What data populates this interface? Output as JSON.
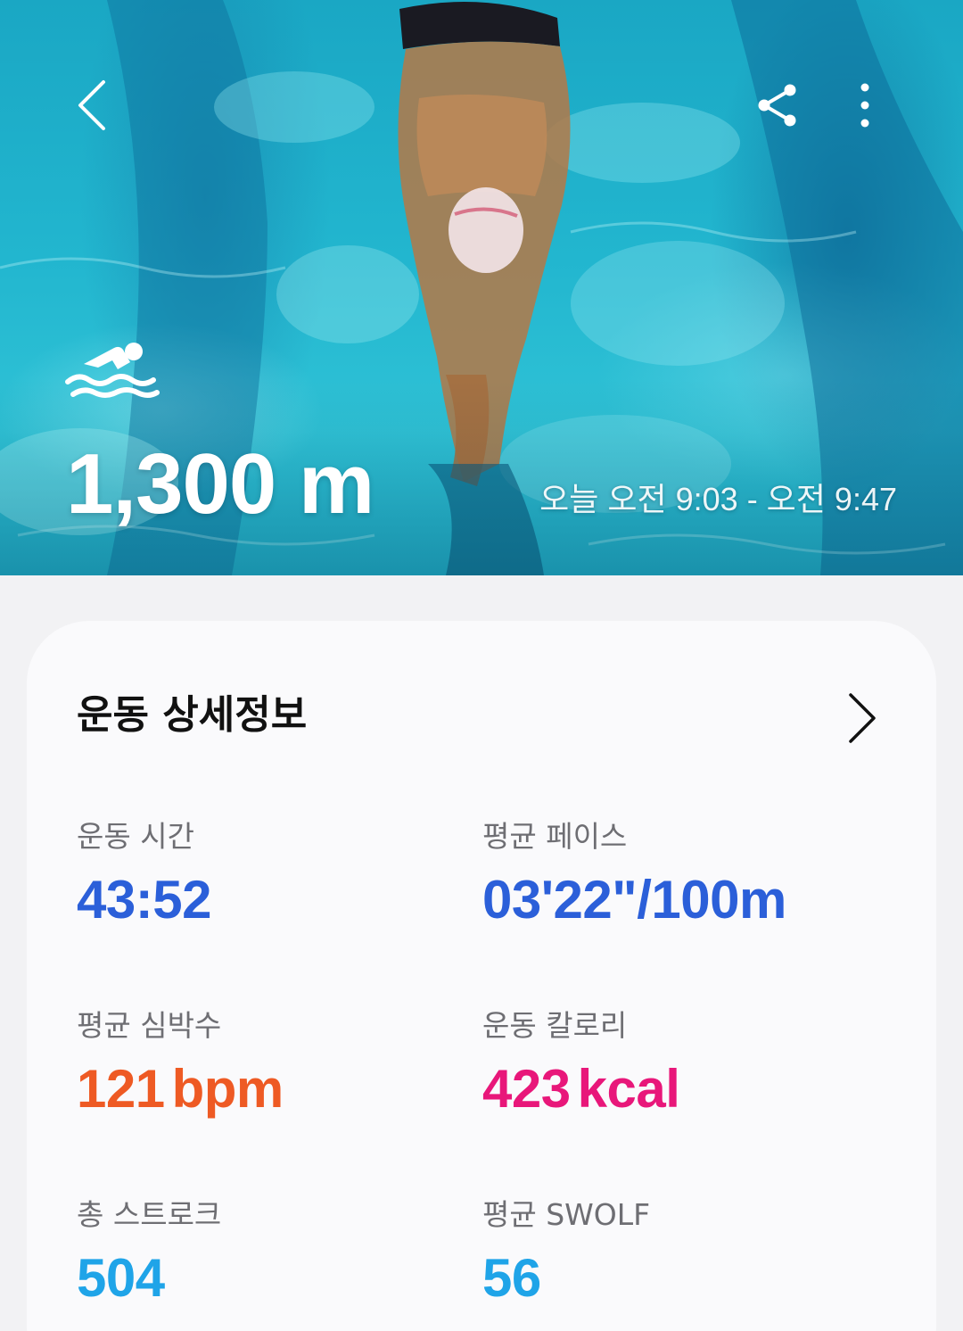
{
  "hero": {
    "distance": "1,300 m",
    "time_range": "오늘 오전 9:03 - 오전 9:47",
    "activity_icon": "swimming-icon"
  },
  "toolbar": {
    "back_icon": "chevron-left-icon",
    "share_icon": "share-icon",
    "more_icon": "more-vertical-icon"
  },
  "details": {
    "title": "운동 상세정보",
    "stats": {
      "duration": {
        "label": "운동 시간",
        "value": "43:52",
        "unit": "",
        "color": "#2b5fd9"
      },
      "pace": {
        "label": "평균 페이스",
        "value": "03'22\"/100m",
        "unit": "",
        "color": "#2b5fd9"
      },
      "heart_rate": {
        "label": "평균 심박수",
        "value": "121",
        "unit": "bpm",
        "color": "#ee5a24"
      },
      "calories": {
        "label": "운동 칼로리",
        "value": "423",
        "unit": "kcal",
        "color": "#e8177a"
      },
      "strokes": {
        "label": "총 스트로크",
        "value": "504",
        "unit": "",
        "color": "#1fa4e8"
      },
      "swolf": {
        "label": "평균 SWOLF",
        "value": "56",
        "unit": "",
        "color": "#1fa4e8"
      }
    }
  }
}
